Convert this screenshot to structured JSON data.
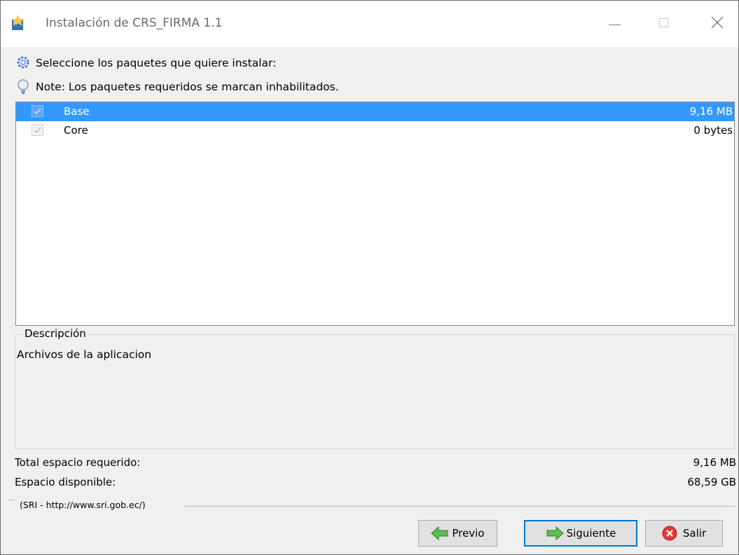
{
  "window": {
    "title": "Instalación de CRS_FIRMA 1.1"
  },
  "messages": {
    "select_packages": "Seleccione los paquetes que quiere instalar:",
    "note": "Note: Los paquetes requeridos se marcan inhabilitados."
  },
  "packages": [
    {
      "name": "Base",
      "size": "9,16 MB",
      "checked": true,
      "disabled": true,
      "selected": true
    },
    {
      "name": "Core",
      "size": "0 bytes",
      "checked": true,
      "disabled": true,
      "selected": false
    }
  ],
  "description": {
    "legend": "Descripción",
    "text": "Archivos de la aplicacion"
  },
  "space": {
    "required_label": "Total espacio requerido:",
    "required_value": "9,16 MB",
    "available_label": "Espacio disponible:",
    "available_value": "68,59 GB"
  },
  "footer": {
    "vendor": "(SRI - http://www.sri.gob.ec/)"
  },
  "buttons": {
    "previous": "Previo",
    "next": "Siguiente",
    "exit": "Salir"
  },
  "colors": {
    "selection": "#3399ff",
    "default_button_border": "#0078d7",
    "arrow_green": "#4caf50",
    "exit_red": "#d32f2f"
  }
}
